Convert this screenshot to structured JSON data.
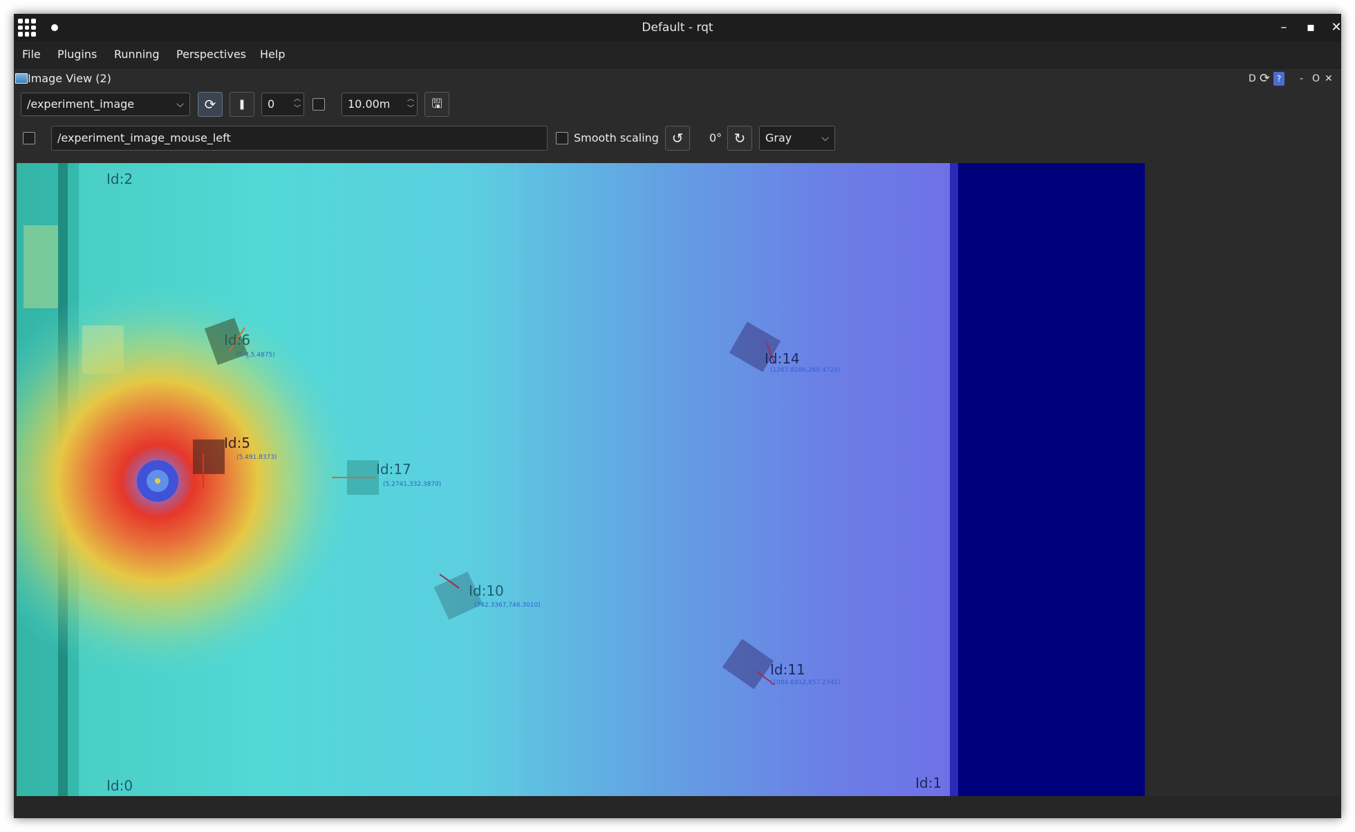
{
  "window": {
    "title": "Default - rqt"
  },
  "menu": [
    "File",
    "Plugins",
    "Running",
    "Perspectives",
    "Help"
  ],
  "panel": {
    "title": "Image View (2)",
    "header_buttons": {
      "dock": "D",
      "reload": "⟳",
      "help": "?",
      "minimize": "-",
      "float": "O",
      "close": "✕"
    }
  },
  "toolbar": {
    "topic": "/experiment_image",
    "number": "0",
    "timeout": "10.00m",
    "mouse_topic": "/experiment_image_mouse_left",
    "smooth_scaling_label": "Smooth scaling",
    "rotation": "0°",
    "colormap": "Gray"
  },
  "image": {
    "colors": {
      "heat_center": "#e5372a",
      "cyan": "#4dd6d0",
      "blue_right": "#6f6fe6",
      "dark_band": "#00007a"
    },
    "markers": [
      {
        "id": "Id:2",
        "pose": ""
      },
      {
        "id": "Id:6",
        "pose": "(5.4̲,5.4875)"
      },
      {
        "id": "Id:5",
        "pose": "(5.491.8373)"
      },
      {
        "id": "Id:17",
        "pose": "(5.2741,332.3870)"
      },
      {
        "id": "Id:14",
        "pose": "(1267.8286,268.4724)"
      },
      {
        "id": "Id:10",
        "pose": "(742.3367,746.3010)"
      },
      {
        "id": "Id:11",
        "pose": "(1084.6812,857.2341)"
      },
      {
        "id": "Id:0",
        "pose": ""
      },
      {
        "id": "Id:1",
        "pose": ""
      }
    ]
  }
}
